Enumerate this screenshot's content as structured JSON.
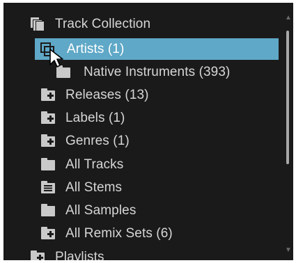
{
  "tree": {
    "items": [
      {
        "label": "Track Collection",
        "icon": "collection-icon",
        "level": 0,
        "selected": false
      },
      {
        "label": "Artists (1)",
        "icon": "artists-icon",
        "level": 1,
        "selected": true
      },
      {
        "label": "Native Instruments (393)",
        "icon": "folder-icon",
        "level": 2,
        "selected": false
      },
      {
        "label": "Releases (13)",
        "icon": "folder-plus-icon",
        "level": 1,
        "selected": false
      },
      {
        "label": "Labels (1)",
        "icon": "folder-plus-icon",
        "level": 1,
        "selected": false
      },
      {
        "label": "Genres (1)",
        "icon": "folder-plus-icon",
        "level": 1,
        "selected": false
      },
      {
        "label": "All Tracks",
        "icon": "folder-icon",
        "level": 1,
        "selected": false
      },
      {
        "label": "All Stems",
        "icon": "stems-icon",
        "level": 1,
        "selected": false
      },
      {
        "label": "All Samples",
        "icon": "folder-icon",
        "level": 1,
        "selected": false
      },
      {
        "label": "All Remix Sets (6)",
        "icon": "folder-plus-icon",
        "level": 1,
        "selected": false
      },
      {
        "label": "Playlists",
        "icon": "folder-plus-icon",
        "level": 0,
        "selected": false
      }
    ]
  },
  "colors": {
    "background": "#1a1a1a",
    "selection": "#5fa8c7",
    "text": "#d6d6d6",
    "icon": "#c9c9c9"
  },
  "scroll": {
    "up_icon": "scroll-up-arrow-icon",
    "down_icon": "scroll-down-arrow-icon"
  }
}
